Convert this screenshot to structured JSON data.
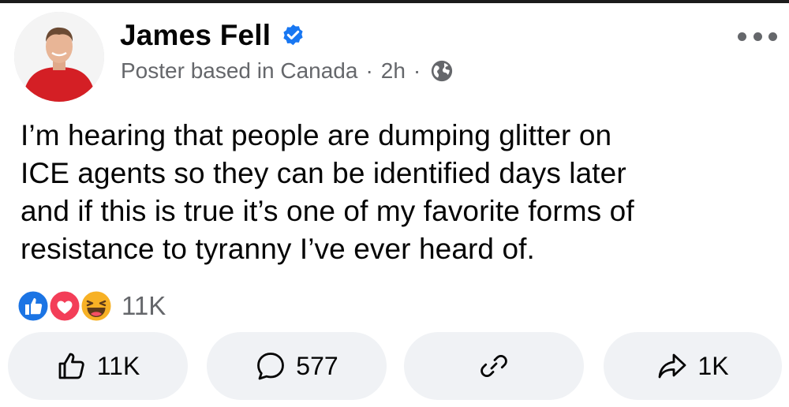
{
  "post": {
    "author": {
      "name": "James Fell",
      "verified_icon": "verified-badge-icon",
      "avatar_icon": "profile-photo"
    },
    "meta": {
      "subtitle": "Poster based in Canada",
      "separator": "·",
      "time": "2h",
      "audience_icon": "globe-icon"
    },
    "menu_icon": "more-options-icon",
    "text_lines": [
      "I’m hearing that people are dumping glitter on",
      "ICE agents so they can be identified days later",
      "and if this is true it’s one of my favorite forms of",
      "resistance to tyranny I’ve ever heard of."
    ],
    "reactions": {
      "icons": [
        "like-reaction-icon",
        "love-reaction-icon",
        "haha-reaction-icon"
      ],
      "count": "11K"
    },
    "actions": {
      "like": {
        "icon": "thumbs-up-icon",
        "count": "11K"
      },
      "comment": {
        "icon": "comment-bubble-icon",
        "count": "577"
      },
      "link": {
        "icon": "link-icon"
      },
      "share": {
        "icon": "share-arrow-icon",
        "count": "1K"
      }
    }
  },
  "colors": {
    "text": "#050505",
    "secondary_text": "#65676b",
    "verified_blue": "#1877f2",
    "like_blue": "#1b74e4",
    "love_red": "#f33e58",
    "haha_yellow": "#f7b125",
    "button_bg": "#f0f2f5"
  }
}
